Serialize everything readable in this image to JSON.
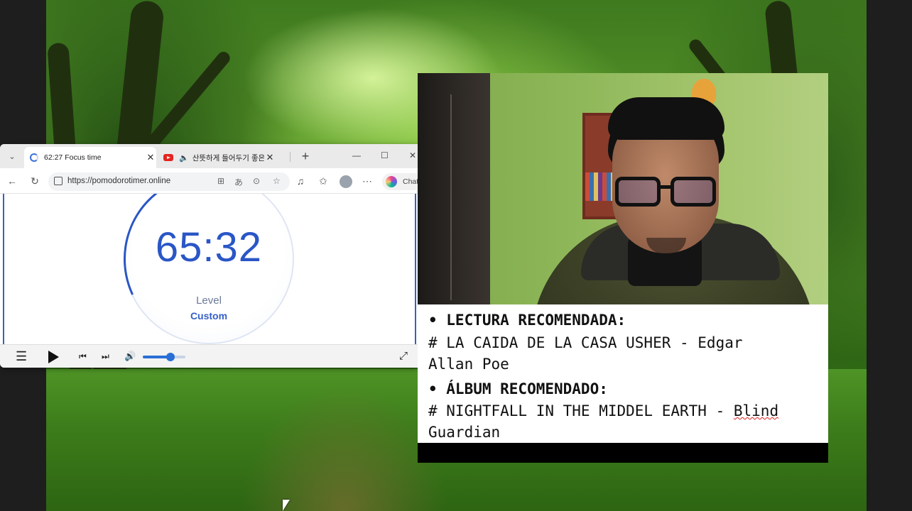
{
  "browser": {
    "tabs": [
      {
        "title": "62:27 Focus time",
        "active": true
      },
      {
        "title": "산뜻하게 들어두기 좋은",
        "active": false
      }
    ],
    "address_url": "https://pomodorotimer.online",
    "copilot_label": "Chat"
  },
  "timer": {
    "display": "65:32",
    "level_label": "Level",
    "level_value": "Custom"
  },
  "player": {
    "volume_fraction": 0.65
  },
  "captions": {
    "reading_header": "• LECTURA RECOMENDADA:",
    "reading_line1": "# LA CAIDA DE LA CASA USHER - Edgar",
    "reading_line2": "Allan Poe",
    "album_header": "• ÁLBUM RECOMENDADO:",
    "album_line1_prefix": "# NIGHTFALL IN THE MIDDEL EARTH - ",
    "album_line1_word": "Blind",
    "album_line2": "Guardian"
  },
  "colors": {
    "timer_blue": "#2a56c6",
    "accent_blue": "#2a6fd6"
  }
}
